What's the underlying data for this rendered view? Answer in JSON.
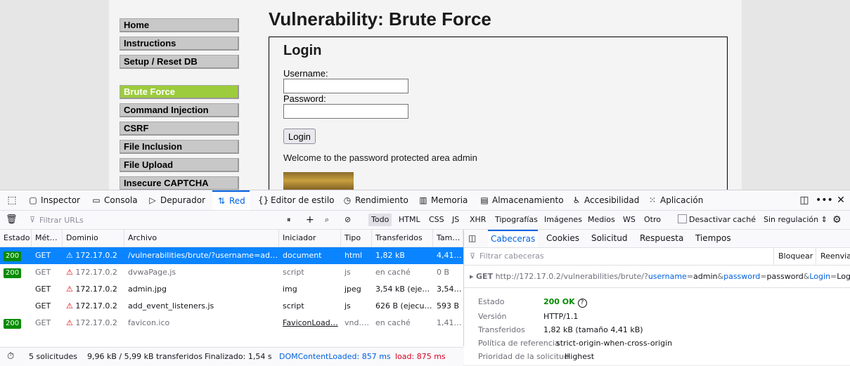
{
  "page": {
    "title": "Vulnerability: Brute Force",
    "menu": [
      "Home",
      "Instructions",
      "Setup / Reset DB",
      "Brute Force",
      "Command Injection",
      "CSRF",
      "File Inclusion",
      "File Upload",
      "Insecure CAPTCHA"
    ],
    "login": {
      "heading": "Login",
      "username_label": "Username:",
      "password_label": "Password:",
      "button": "Login",
      "welcome": "Welcome to the password protected area admin"
    }
  },
  "devtools": {
    "tabs": [
      "Inspector",
      "Consola",
      "Depurador",
      "Red",
      "Editor de estilo",
      "Rendimiento",
      "Memoria",
      "Almacenamiento",
      "Accesibilidad",
      "Aplicación"
    ],
    "active_tab": "Red",
    "filter_placeholder": "Filtrar URLs",
    "type_filters": [
      "Todo",
      "HTML",
      "CSS",
      "JS",
      "XHR",
      "Tipografías",
      "Imágenes",
      "Medios",
      "WS",
      "Otro"
    ],
    "disable_cache": "Desactivar caché",
    "throttling": "Sin regulación",
    "columns": [
      "Estado",
      "Mét…",
      "Dominio",
      "Archivo",
      "Iniciador",
      "Tipo",
      "Transferidos",
      "Tam…"
    ],
    "requests": [
      {
        "status": "200",
        "method": "GET",
        "domain": "172.17.0.2",
        "file": "/vulnerabilities/brute/?username=admin&password=password&Login=Login",
        "initiator": "document",
        "type": "html",
        "transferred": "1,82 kB",
        "size": "4,41…"
      },
      {
        "status": "200",
        "method": "GET",
        "domain": "172.17.0.2",
        "file": "dvwaPage.js",
        "initiator": "script",
        "type": "js",
        "transferred": "en caché",
        "size": "0 B"
      },
      {
        "status": "",
        "method": "GET",
        "domain": "172.17.0.2",
        "file": "admin.jpg",
        "initiator": "img",
        "type": "jpeg",
        "transferred": "3,54 kB (ejec…",
        "size": "3,54…"
      },
      {
        "status": "",
        "method": "GET",
        "domain": "172.17.0.2",
        "file": "add_event_listeners.js",
        "initiator": "script",
        "type": "js",
        "transferred": "626 B (ejecut…",
        "size": "593 B"
      },
      {
        "status": "200",
        "method": "GET",
        "domain": "172.17.0.2",
        "file": "favicon.ico",
        "initiator": "FaviconLoad…",
        "type": "vnd.…",
        "transferred": "en caché",
        "size": "1,41…"
      }
    ],
    "statusbar": {
      "requests": "5 solicitudes",
      "transferred": "9,96 kB / 5,99 kB transferidos",
      "finished": "Finalizado: 1,54 s",
      "dcl": "DOMContentLoaded: 857 ms",
      "load": "load: 875 ms"
    },
    "side": {
      "tabs": [
        "Cabeceras",
        "Cookies",
        "Solicitud",
        "Respuesta",
        "Tiempos"
      ],
      "active_tab": "Cabeceras",
      "filter_placeholder": "Filtrar cabeceras",
      "block": "Bloquear",
      "resend": "Reenviar",
      "req_method": "GET",
      "req_base": "http://172.17.0.2/vulnerabilities/brute/?",
      "params": [
        {
          "key": "username",
          "value": "admin"
        },
        {
          "key": "password",
          "value": "password"
        },
        {
          "key": "Login",
          "value": "Login"
        }
      ],
      "fields": [
        {
          "label": "Estado",
          "value": "200 OK"
        },
        {
          "label": "Versión",
          "value": "HTTP/1.1"
        },
        {
          "label": "Transferidos",
          "value": "1,82 kB (tamaño 4,41 kB)"
        },
        {
          "label": "Política de referencia",
          "value": "strict-origin-when-cross-origin"
        },
        {
          "label": "Prioridad de la solicitud",
          "value": "Highest"
        }
      ]
    },
    "colors": {
      "accent": "#0061e0",
      "selected_row": "#0a84ff",
      "status_ok": "#058b00",
      "dcl": "#0061e0",
      "load": "#d70022",
      "param_key": "#0061e0",
      "param_val": "#15141a"
    }
  }
}
